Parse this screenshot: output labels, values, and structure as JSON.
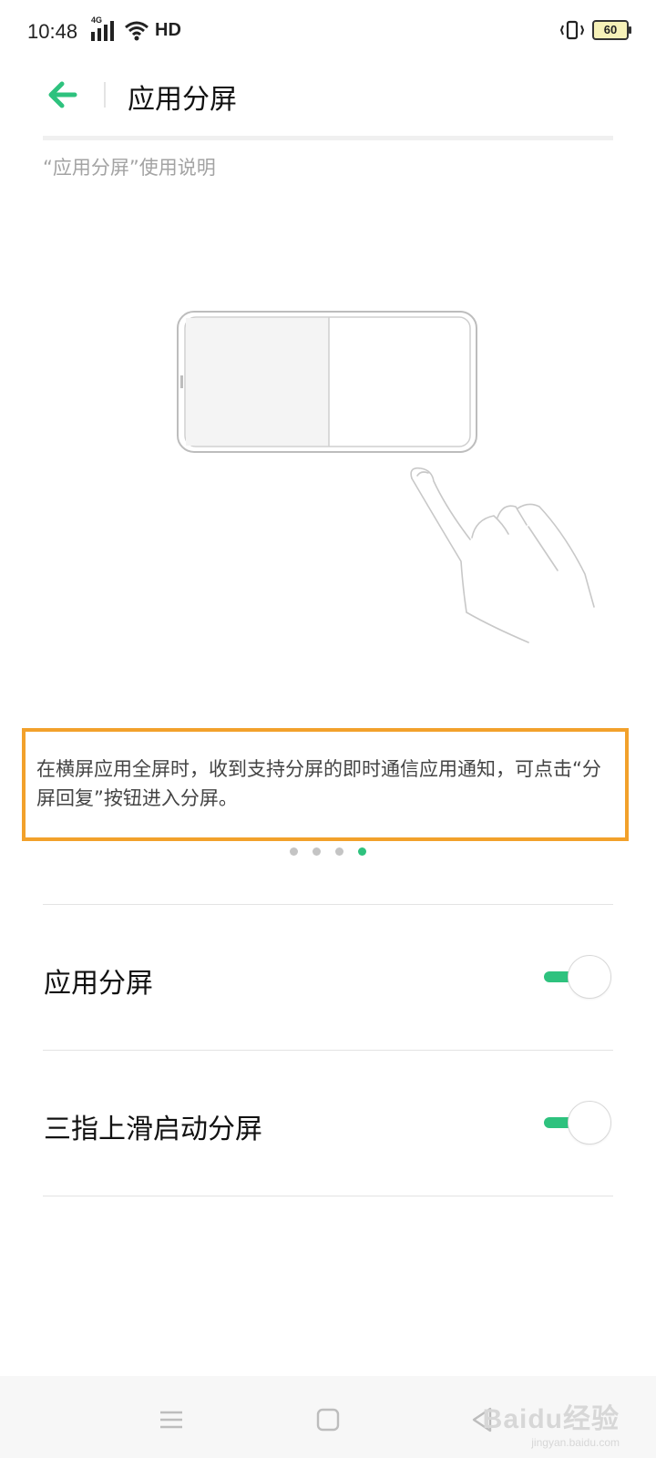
{
  "status_bar": {
    "time": "10:48",
    "network_label": "4G",
    "hd_label": "HD",
    "battery_level": "60",
    "icons": [
      "signal-icon",
      "wifi-icon",
      "vibrate-icon",
      "battery-icon"
    ]
  },
  "header": {
    "title": "应用分屏",
    "back_icon": "back-arrow-icon"
  },
  "section": {
    "caption": "“应用分屏”使用说明"
  },
  "tutorial": {
    "description": "在横屏应用全屏时，收到支持分屏的即时通信应用通知，可点击“分屏回复”按钮进入分屏。",
    "page_count": 4,
    "current_page": 4
  },
  "settings": [
    {
      "label": "应用分屏",
      "enabled": true
    },
    {
      "label": "三指上滑启动分屏",
      "enabled": true
    }
  ],
  "nav_bar": {
    "buttons": [
      "menu-icon",
      "home-icon",
      "back-icon"
    ],
    "watermark": "Baidu经验",
    "watermark_sub": "jingyan.baidu.com"
  },
  "colors": {
    "accent": "#2ec27e",
    "highlight_border": "#f2a12b",
    "caption_gray": "#a3a3a3",
    "text_body": "#444444"
  }
}
